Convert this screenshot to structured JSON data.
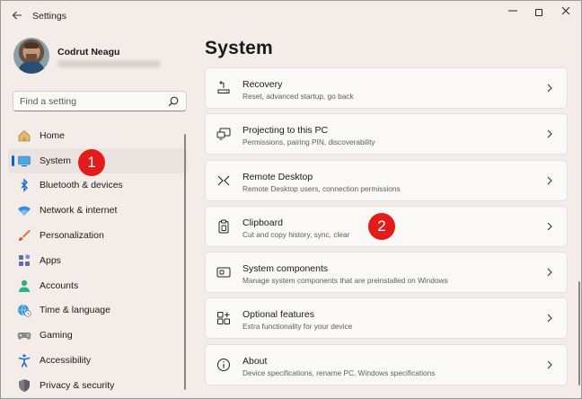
{
  "window": {
    "title": "Settings",
    "controls": {
      "minimize": "—",
      "close": "✕"
    }
  },
  "profile": {
    "name": "Codrut Neagu"
  },
  "search": {
    "placeholder": "Find a setting"
  },
  "nav": {
    "items": [
      {
        "label": "Home",
        "icon": "home-icon"
      },
      {
        "label": "System",
        "icon": "system-icon",
        "selected": true
      },
      {
        "label": "Bluetooth & devices",
        "icon": "bluetooth-icon"
      },
      {
        "label": "Network & internet",
        "icon": "wifi-icon"
      },
      {
        "label": "Personalization",
        "icon": "brush-icon"
      },
      {
        "label": "Apps",
        "icon": "apps-icon"
      },
      {
        "label": "Accounts",
        "icon": "person-icon"
      },
      {
        "label": "Time & language",
        "icon": "globe-clock-icon"
      },
      {
        "label": "Gaming",
        "icon": "gamepad-icon"
      },
      {
        "label": "Accessibility",
        "icon": "accessibility-icon"
      },
      {
        "label": "Privacy & security",
        "icon": "shield-icon"
      }
    ]
  },
  "page": {
    "title": "System",
    "cards": [
      {
        "title": "Recovery",
        "subtitle": "Reset, advanced startup, go back",
        "icon": "recovery-icon"
      },
      {
        "title": "Projecting to this PC",
        "subtitle": "Permissions, pairing PIN, discoverability",
        "icon": "projecting-icon"
      },
      {
        "title": "Remote Desktop",
        "subtitle": "Remote Desktop users, connection permissions",
        "icon": "remote-desktop-icon"
      },
      {
        "title": "Clipboard",
        "subtitle": "Cut and copy history, sync, clear",
        "icon": "clipboard-icon"
      },
      {
        "title": "System components",
        "subtitle": "Manage system components that are preinstalled on Windows",
        "icon": "system-components-icon"
      },
      {
        "title": "Optional features",
        "subtitle": "Extra functionality for your device",
        "icon": "optional-features-icon"
      },
      {
        "title": "About",
        "subtitle": "Device specifications, rename PC, Windows specifications",
        "icon": "info-icon"
      }
    ]
  },
  "annotations": {
    "badge1": "1",
    "badge2": "2",
    "color": "#e31b1b"
  },
  "colors": {
    "accent": "#0067c0",
    "background": "#f4ece8",
    "card": "#fbf9f8"
  }
}
